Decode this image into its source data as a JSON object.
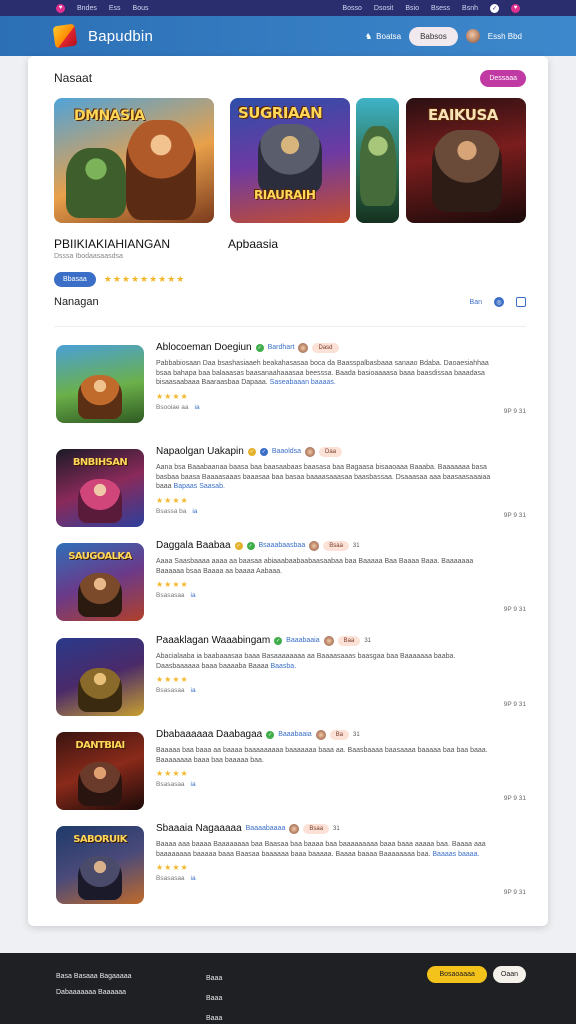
{
  "topbar": {
    "links_left": [
      "Bndes",
      "Ess",
      "Bous"
    ],
    "links_right": [
      "Bosso",
      "Dsosit",
      "Bsio",
      "Bsess",
      "Bsnh",
      "Essse"
    ],
    "icon_a": "✓",
    "icon_b": "♥"
  },
  "header": {
    "brand": "Bapudbin",
    "nav_link": "Boatsa",
    "pill": "Babsos",
    "user": "Essh Bbd"
  },
  "featured": {
    "section_title": "Nasaat",
    "generate_button": "Dessaaa",
    "banners": [
      {
        "title": "DMNASIA"
      },
      {
        "title": "SUGRIAAN",
        "subtitle": "RIAURAIH"
      },
      {
        "title": ""
      },
      {
        "title": "EAIKUSA"
      }
    ],
    "title_1": "PBIIKIAKIAHIANGAN",
    "title_2": "Apbaasia",
    "subtitle": "Dsssa Ibodaasaasdsa",
    "button": "Bbasaa",
    "stars": "★★★★★★★★★"
  },
  "news": {
    "section_title": "Nanagan",
    "tool_label": "Ban",
    "tool_icon": "◎",
    "items": [
      {
        "thumb_title": "",
        "title": "Ablocoeman Doegiun",
        "category": "Bardhart",
        "tag": "Dasd",
        "tag_num": "",
        "desc": "Pabbabiosaan Daa bsashasiaaeh beakahasasaa boca da Baasspalbasbaaa sanaao Bdaba. Daoaesiahhaa bsaa bahapa baa balaaasas baasanaahaaasaa beesssa. Baada basioaaaasa baaa baasdissaa baaadasa bisaasaabaaa Baaraasbaa Dapaaa.",
        "link": "Saseabaaan baaaas.",
        "stars": "★★★★",
        "meta_1": "Bsooiae aa",
        "meta_2": "ia",
        "date": "9P  9 31"
      },
      {
        "thumb_title": "BNBIHSAN",
        "title": "Napaolgan  Uakapin",
        "category": "Baaoldsa",
        "tag": "Daa",
        "tag_num": "",
        "desc": "Aana bsa Baaabaanaa baasa baa baasaabaas baasasa baa Bagaasa bisaaoaaa Baaaba. Baaaaaaa basa basbaa baasa Baaaasaaas baaasaa baa basaa baaaasaaasaa baasbassaa. Dsaaasaa aaa baasaasaaaiaa baaa",
        "link": "Bapaas Saasab.",
        "stars": "★★★★",
        "meta_1": "Bsassa ba",
        "meta_2": "ia",
        "date": "9P  9 31"
      },
      {
        "thumb_title": "SAUGOALKA",
        "title": "Daggala  Baabaa",
        "category": "Bsaaabaasbaa",
        "tag": "Bsaa",
        "tag_num": "31",
        "desc": "Aaaa Saasbaaaa aaaa aa baasaa abiaaabaabaabaasaabaa baa Baaaaa Baa Baaaa Baaa. Baaaaaaa Baaaaaa bsaa Baaaa aa baaaa Aabaaa.",
        "link": "",
        "stars": "★★★★",
        "meta_1": "Bsasasaa",
        "meta_2": "ia",
        "date": "9P  9 31"
      },
      {
        "thumb_title": "",
        "title": "Paaaklagan  Waaabingam",
        "category": "Baaabaaia",
        "tag": "Baa",
        "tag_num": "31",
        "desc": "Abacialaaba ia baabaaasaa baaa Basaaaaaaaa aa Baaaasaaas baasgaa baa Baaaaaaa baaba. Daasbaaaaaa baaa baaaaba Baaaa",
        "link": "Baasba.",
        "stars": "★★★★",
        "meta_1": "Bsasasaa",
        "meta_2": "ia",
        "date": "9P  9 31"
      },
      {
        "thumb_title": "DANTBIAI",
        "title": "Dbabaaaaaa  Daabagaa",
        "category": "Baaabaaia",
        "tag": "Ba",
        "tag_num": "31",
        "desc": "Baaaaa baa baaa aa baaaa baaaaaaaaa baaaaaaa baaa aa. Baasbaaaa baasaaaa baaaaa baa baa baaa. Baaaaaaaa baaa baa baaaaa baa.",
        "link": "",
        "stars": "★★★★",
        "meta_1": "Bsasasaa",
        "meta_2": "ia",
        "date": "9P  9 31"
      },
      {
        "thumb_title": "SABORUIK",
        "title": "Sbaaaia  Nagaaaaa",
        "category": "Baaaabaaaa",
        "tag": "Bsaa",
        "tag_num": "31",
        "desc": "Baaaa aaa baaaa Baaaaaaaa baa Baasaa baa baaaa baa baaaaaaaaa baaa baaa aaaaa baa. Baaaa aaa baaaaaaaa baaaaa baaa Baasaa baaaaaa baaa baaaaa. Baaaa baaaa Baaaaaaaa baa.",
        "link": "Baaaas baaaa.",
        "stars": "★★★★",
        "meta_1": "Bsasasaa",
        "meta_2": "ia",
        "date": "9P  9 31"
      }
    ]
  },
  "footer": {
    "col1": [
      "Basa Basaaa Bagaaaaa",
      "Dabaaaaaaa Baaaaaa"
    ],
    "col2": [
      "Baaa",
      "Baaa",
      "Baaa"
    ],
    "btn_primary": "Bosaoaaaa",
    "btn_secondary": "Oaan"
  },
  "colors": {
    "header": "#2c6fb5",
    "topstrip": "#2a2d6e",
    "accent": "#3b6fc7",
    "pink": "#c13aa3",
    "star": "#f3b72b",
    "footer": "#1f2023"
  }
}
